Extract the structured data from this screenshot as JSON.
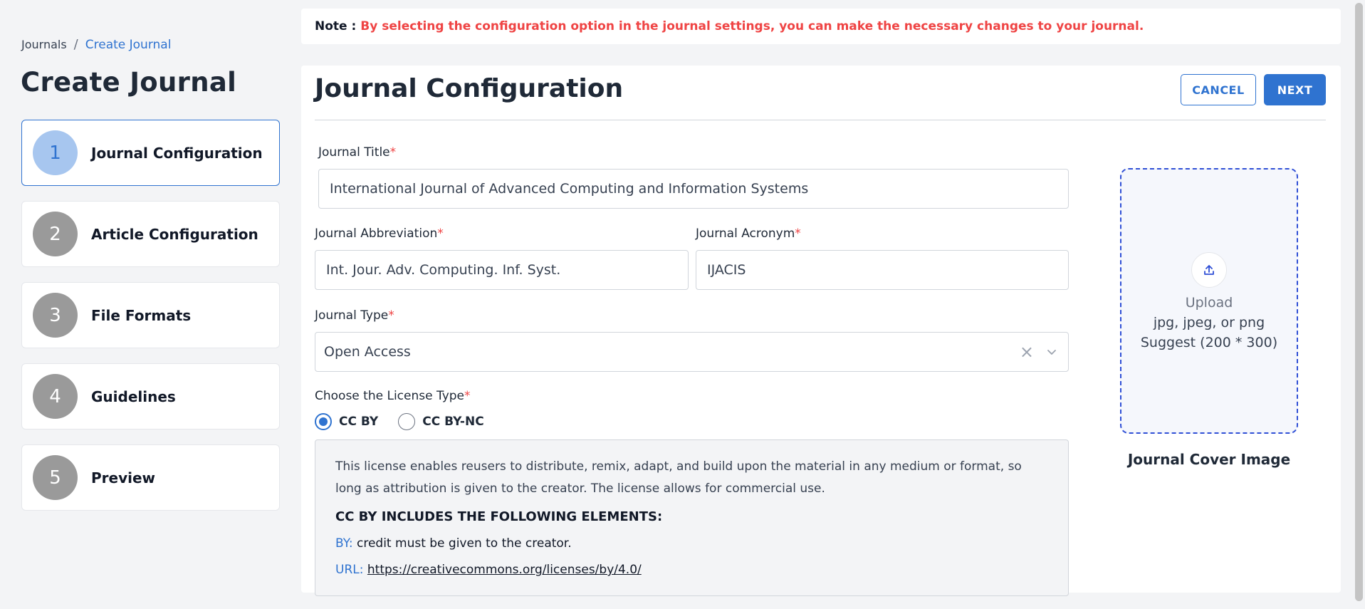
{
  "breadcrumb": {
    "root": "Journals",
    "separator": "/",
    "current": "Create Journal"
  },
  "page_title": "Create Journal",
  "steps": [
    {
      "number": "1",
      "label": "Journal Configuration",
      "active": true
    },
    {
      "number": "2",
      "label": "Article Configuration",
      "active": false
    },
    {
      "number": "3",
      "label": "File Formats",
      "active": false
    },
    {
      "number": "4",
      "label": "Guidelines",
      "active": false
    },
    {
      "number": "5",
      "label": "Preview",
      "active": false
    }
  ],
  "note": {
    "label": "Note :",
    "text": "By selecting the configuration option in the journal settings, you can make the necessary changes to your journal."
  },
  "card": {
    "title": "Journal Configuration",
    "cancel_label": "CANCEL",
    "next_label": "NEXT"
  },
  "form": {
    "title_label": "Journal Title",
    "title_value": "International Journal of Advanced Computing and Information Systems",
    "abbreviation_label": "Journal Abbreviation",
    "abbreviation_value": "Int. Jour. Adv. Computing. Inf. Syst.",
    "acronym_label": "Journal Acronym",
    "acronym_value": "IJACIS",
    "type_label": "Journal Type",
    "type_value": "Open Access",
    "license_label": "Choose the License Type",
    "required_mark": "*",
    "license_options": [
      {
        "label": "CC BY",
        "checked": true
      },
      {
        "label": "CC BY-NC",
        "checked": false
      }
    ]
  },
  "license_info": {
    "description": "This license enables reusers to distribute, remix, adapt, and build upon the material in any medium or format, so long as attribution is given to the creator. The license allows for commercial use.",
    "heading": "CC BY INCLUDES THE FOLLOWING ELEMENTS:",
    "by_key": "BY:",
    "by_value": "credit must be given to the creator.",
    "url_key": "URL:",
    "url_value": "https://creativecommons.org/licenses/by/4.0/"
  },
  "upload": {
    "icon": "upload-icon",
    "label": "Upload",
    "formats": "jpg, jpeg, or png",
    "suggest": "Suggest (200 * 300)",
    "caption": "Journal Cover Image"
  },
  "colors": {
    "accent": "#2f73d0",
    "required": "#ef4444",
    "note_text": "#ef4444",
    "step_inactive": "#9a9a9a",
    "step_active_bg": "#a7c6ef",
    "upload_border": "#2f4fd6"
  }
}
